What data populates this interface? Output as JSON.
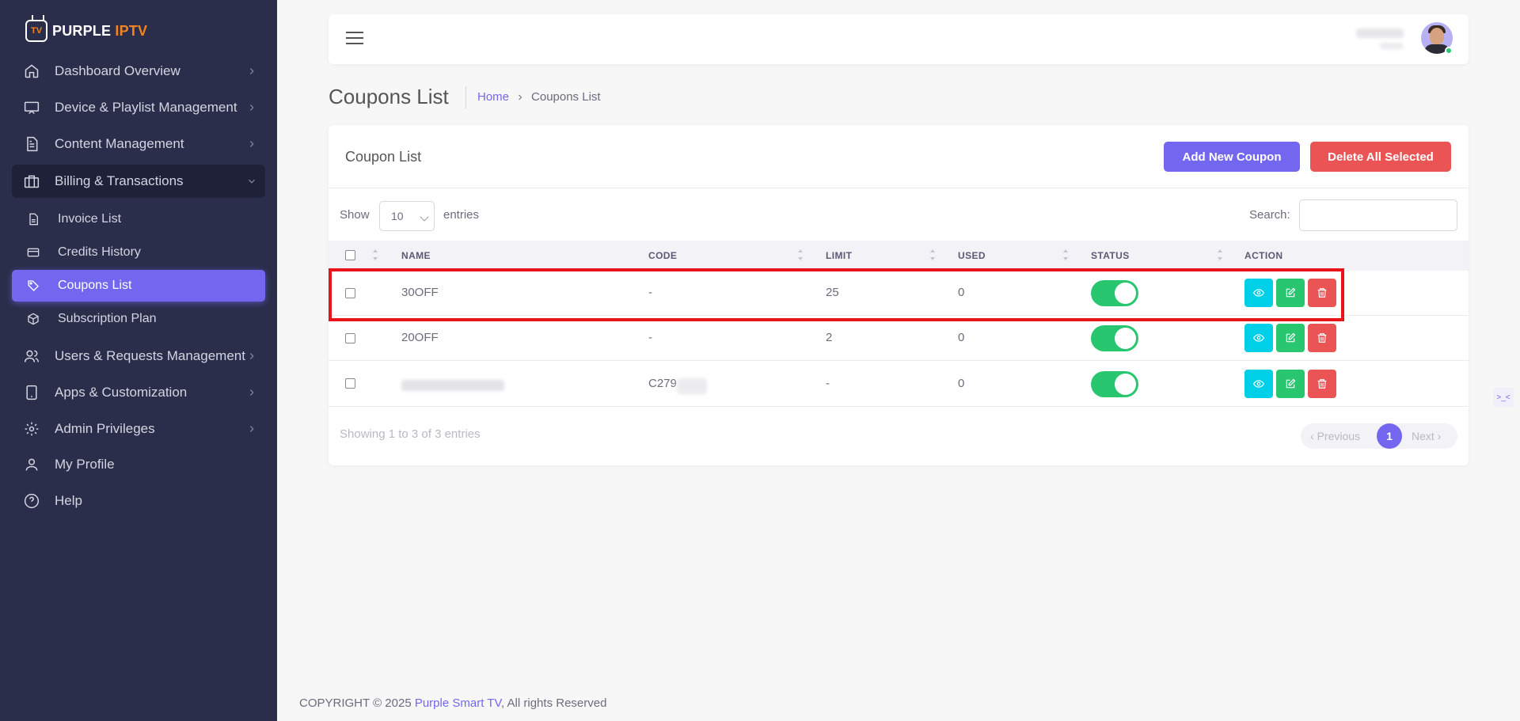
{
  "brand": {
    "name_part1": "PURPLE",
    "name_part2": "IPTV",
    "logo_badge": "TV"
  },
  "sidebar": {
    "items": [
      {
        "label": "Dashboard Overview",
        "icon": "home-icon"
      },
      {
        "label": "Device & Playlist Management",
        "icon": "monitor-icon"
      },
      {
        "label": "Content Management",
        "icon": "document-icon"
      },
      {
        "label": "Billing & Transactions",
        "icon": "briefcase-icon"
      },
      {
        "label": "Users & Requests Management",
        "icon": "users-icon"
      },
      {
        "label": "Apps & Customization",
        "icon": "tablet-icon"
      },
      {
        "label": "Admin Privileges",
        "icon": "gear-icon"
      },
      {
        "label": "My Profile",
        "icon": "user-icon"
      },
      {
        "label": "Help",
        "icon": "help-circle-icon"
      }
    ],
    "billing_subitems": [
      {
        "label": "Invoice List",
        "icon": "file-icon"
      },
      {
        "label": "Credits History",
        "icon": "credit-card-icon"
      },
      {
        "label": "Coupons List",
        "icon": "tag-icon"
      },
      {
        "label": "Subscription Plan",
        "icon": "box-icon"
      }
    ]
  },
  "page": {
    "title": "Coupons List",
    "breadcrumb_home": "Home",
    "breadcrumb_current": "Coupons List"
  },
  "card": {
    "title": "Coupon List",
    "add_button": "Add New Coupon",
    "delete_all_button": "Delete All Selected",
    "show_label": "Show",
    "entries_value": "10",
    "entries_label": "entries",
    "search_label": "Search:",
    "columns": [
      "NAME",
      "CODE",
      "LIMIT",
      "USED",
      "STATUS",
      "ACTION"
    ],
    "rows": [
      {
        "name": "30OFF",
        "code": "-",
        "limit": "25",
        "used": "0",
        "status_on": true
      },
      {
        "name": "20OFF",
        "code": "-",
        "limit": "2",
        "used": "0",
        "status_on": true
      },
      {
        "name": "",
        "code": "C279",
        "limit": "-",
        "used": "0",
        "status_on": true
      }
    ],
    "info": "Showing 1 to 3 of 3 entries",
    "pager": {
      "prev": "Previous",
      "current": "1",
      "next": "Next"
    }
  },
  "footer": {
    "prefix": "COPYRIGHT © 2025 ",
    "brand": "Purple Smart TV",
    "suffix": ", All rights Reserved"
  },
  "colors": {
    "sidebar_bg": "#2a2e4a",
    "accent": "#7367f0",
    "danger": "#ea5455",
    "success": "#28c76f",
    "info": "#00cfe8",
    "highlight": "#e8141a"
  }
}
